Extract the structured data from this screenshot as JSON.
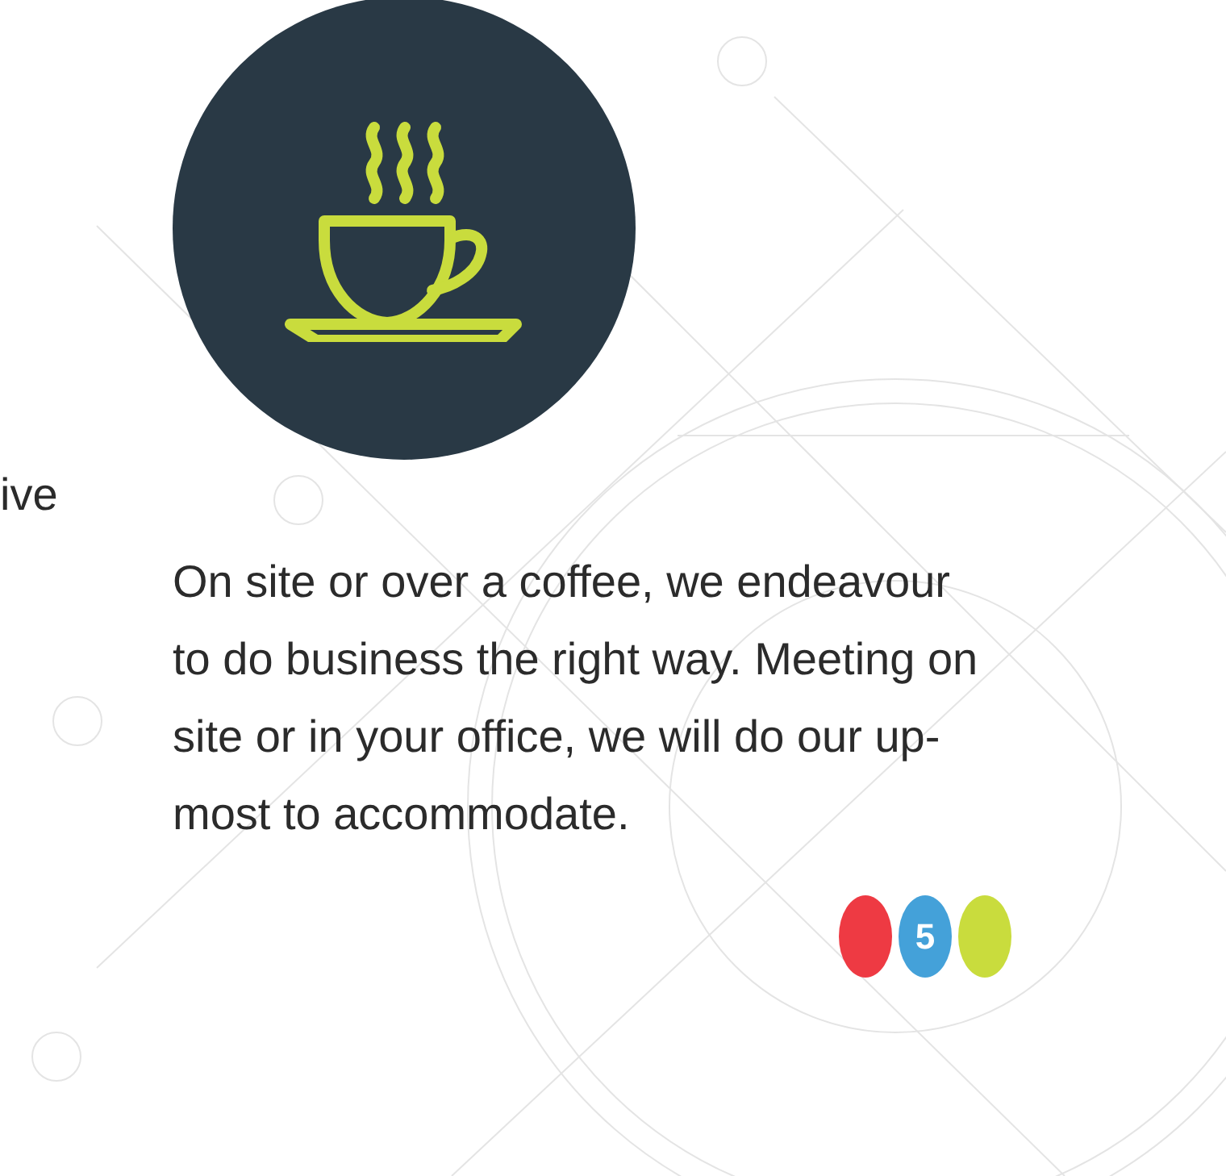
{
  "side_text": "ive",
  "body": "On site or over a coffee, we endeavour to do business the right way. Meeting on site or in your office, we will do our up-most to accommodate.",
  "dots": [
    {
      "color": "#ee3a43"
    },
    {
      "color": "#44a1d9",
      "label": "5"
    },
    {
      "color": "#c9dc3d"
    }
  ]
}
